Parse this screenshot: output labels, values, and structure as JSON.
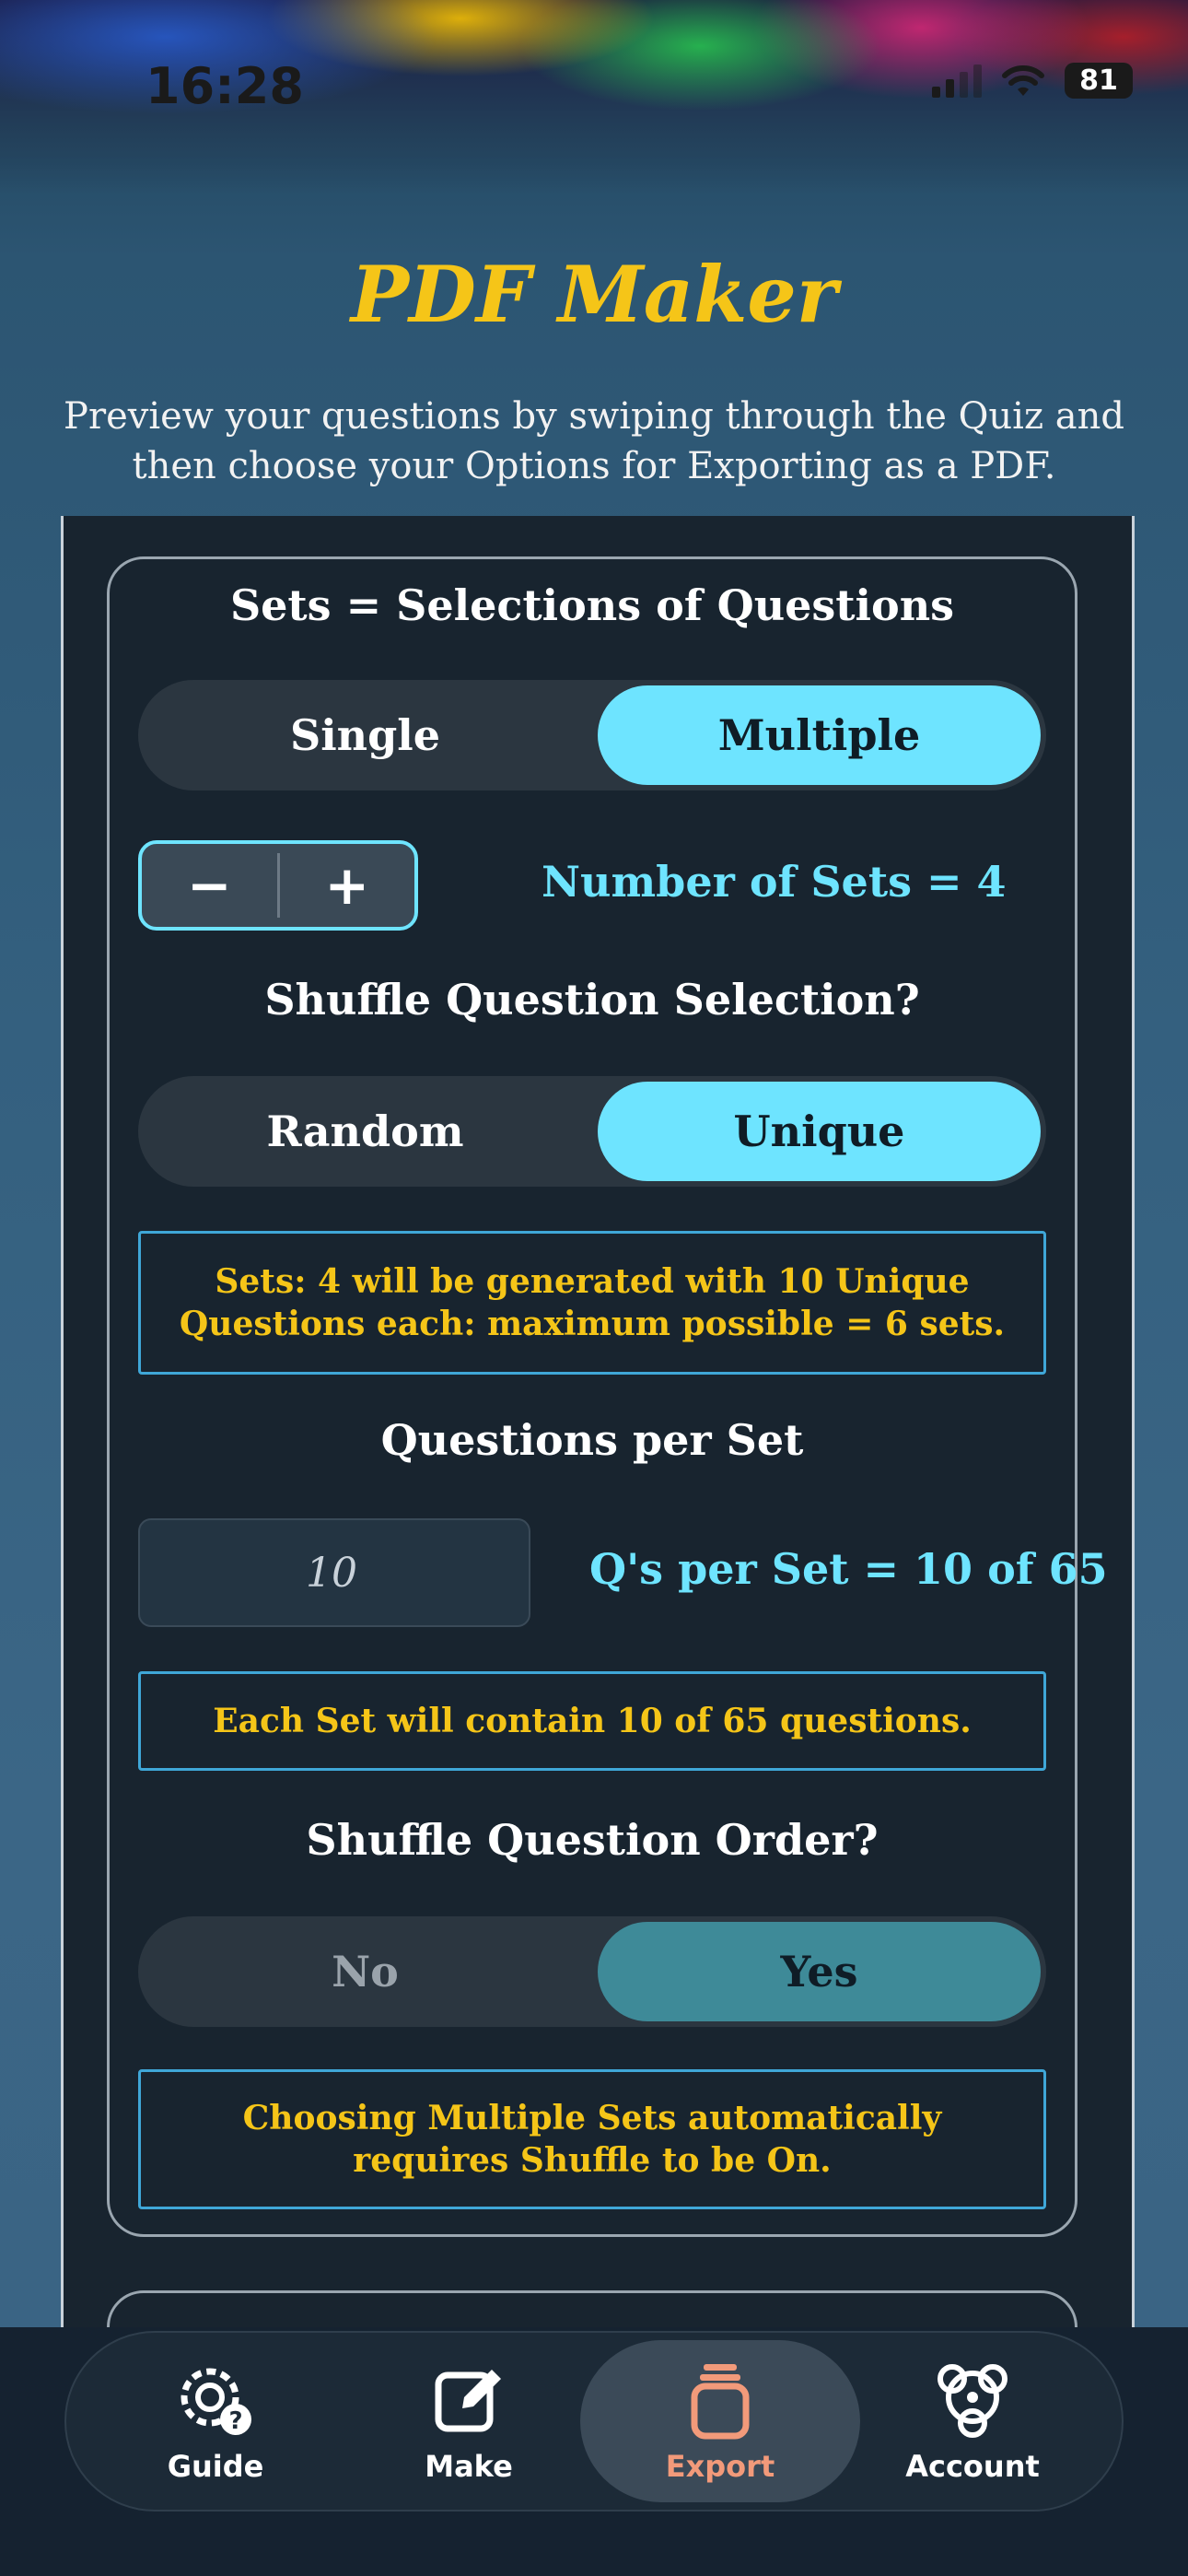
{
  "status_bar": {
    "time": "16:28",
    "battery": "81"
  },
  "header": {
    "title": "PDF Maker",
    "subtitle": "Preview your questions by swiping through the Quiz and then choose your Options for Exporting as a PDF."
  },
  "sets": {
    "heading": "Sets = Selections of Questions",
    "options": [
      "Single",
      "Multiple"
    ],
    "selected": "Multiple",
    "stepper_minus": "−",
    "stepper_plus": "+",
    "number_label": "Number of Sets = 4"
  },
  "shuffle_selection": {
    "heading": "Shuffle Question Selection?",
    "options": [
      "Random",
      "Unique"
    ],
    "selected": "Unique",
    "info": "Sets: 4 will be generated with  10 Unique Questions each: maximum possible = 6 sets."
  },
  "questions_per_set": {
    "heading": "Questions per Set",
    "field_value": "10",
    "label": "Q's per Set = 10 of 65",
    "info": "Each Set will contain 10 of 65 questions."
  },
  "shuffle_order": {
    "heading": "Shuffle Question Order?",
    "options": [
      "No",
      "Yes"
    ],
    "selected": "Yes",
    "info": "Choosing Multiple Sets automatically requires Shuffle to be On."
  },
  "tabbar": {
    "items": [
      {
        "label": "Guide",
        "icon": "gear-help-icon"
      },
      {
        "label": "Make",
        "icon": "edit-icon"
      },
      {
        "label": "Export",
        "icon": "export-icon"
      },
      {
        "label": "Account",
        "icon": "account-icon"
      }
    ],
    "active": "Export"
  },
  "colors": {
    "accent": "#6ee4ff",
    "gold": "#f5c518",
    "panel": "#18242f",
    "active_tab": "#f29a7a"
  }
}
